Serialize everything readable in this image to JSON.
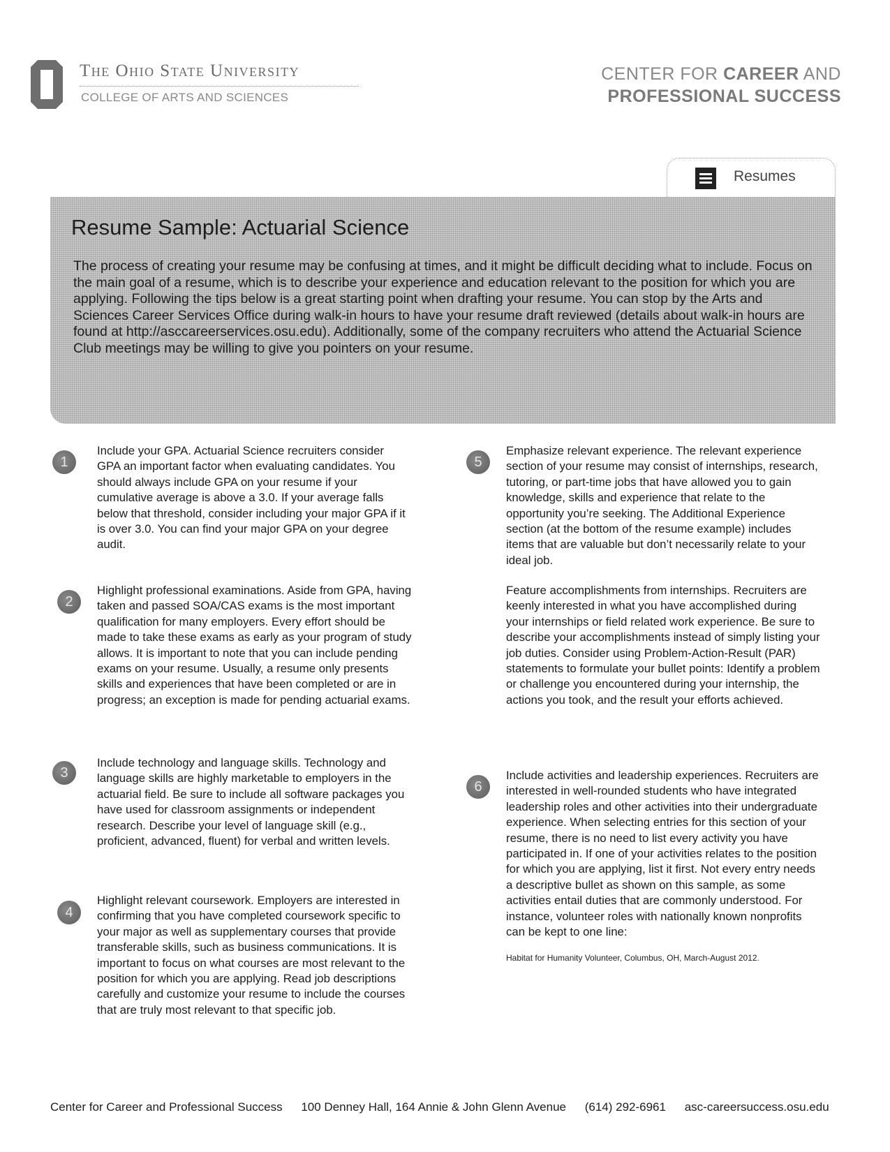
{
  "header": {
    "university": "The Ohio State University",
    "college": "COLLEGE OF ARTS AND SCIENCES",
    "center_line1_light": "CENTER FOR ",
    "center_line1_bold": "CAREER",
    "center_line1_tail": " AND",
    "center_line2": "PROFESSIONAL SUCCESS"
  },
  "tab": {
    "icon": "document-lines-icon",
    "label": "Resumes"
  },
  "banner": {
    "title": "Resume Sample: Actuarial Science",
    "text": "The process of creating your resume may be confusing at times, and it might be difficult deciding what to include. Focus on the main goal of a resume, which is to describe your experience and education relevant to the position for which you are applying. Following the tips below is a great starting point when drafting your resume. You can stop by the Arts and Sciences Career Services Office during walk-in hours to have your resume draft reviewed (details about walk-in hours are found at http://asccareerservices.osu.edu). Additionally, some of the company recruiters who attend the Actuarial Science Club meetings may be willing to give you pointers on your resume."
  },
  "tips": [
    {
      "number": "1",
      "text": "Include your GPA. Actuarial Science recruiters consider GPA an important factor when evaluating candidates. You should always include GPA on your resume if your cumulative average is above a 3.0. If your average falls below that threshold, consider including your major GPA if it is over 3.0. You can find your major GPA on your degree audit."
    },
    {
      "number": "2",
      "text": "Highlight professional examinations. Aside from GPA, having taken and passed SOA/CAS exams is the most important qualification for many employers. Every effort should be made to take these exams as early as your program of study allows. It is important to note that you can include pending exams on your resume. Usually, a resume only presents skills and experiences that have been completed or are in progress; an exception is made for pending actuarial exams."
    },
    {
      "number": "3",
      "text": "Include technology and language skills. Technology and language skills are highly marketable to employers in the actuarial field. Be sure to include all software packages you have used for classroom assignments or independent research. Describe your level of language skill (e.g., proficient, advanced, fluent) for verbal and written levels."
    },
    {
      "number": "4",
      "text": "Highlight relevant coursework. Employers are interested in confirming that you have completed coursework specific to your major as well as supplementary courses that provide transferable skills, such as business communications. It is important to focus on what courses are most relevant to the position for which you are applying. Read job descriptions carefully and customize your resume to include the courses that are truly most relevant to that specific job."
    },
    {
      "number": "5",
      "text": "Emphasize relevant experience. The relevant experience section of your resume may consist of internships, research, tutoring, or part-time jobs that have allowed you to gain knowledge, skills and experience that relate to the opportunity you’re seeking. The Additional Experience section (at the bottom of the resume example) includes items that are valuable but don’t necessarily relate to your ideal job.",
      "extra": "Feature accomplishments from internships. Recruiters are keenly interested in what you have accomplished during your internships or field related work experience. Be sure to describe your accomplishments instead of simply listing your job duties. Consider using Problem-Action-Result (PAR) statements to formulate your bullet points: Identify a problem or challenge you encountered during your internship, the actions you took, and the result your efforts achieved."
    },
    {
      "number": "6",
      "text": "Include activities and leadership experiences. Recruiters are interested in well-rounded students who have integrated leadership roles and other activities into their undergraduate experience. When selecting entries for this section of your resume, there is no need to list every activity you have participated in. If one of your activities relates to the position for which you are applying, list it first. Not every entry needs a descriptive bullet as shown on this sample, as some activities entail duties that are commonly understood. For instance, volunteer roles with nationally known nonprofits can be kept to one line:",
      "example": "Habitat for Humanity Volunteer, Columbus, OH, March-August 2012."
    }
  ],
  "footer": {
    "center": "Center for Career and Professional Success",
    "address": "100 Denney Hall, 164 Annie & John Glenn  Avenue",
    "phone": "(614) 292-6961",
    "website": "asc-careersuccess.osu.edu"
  }
}
